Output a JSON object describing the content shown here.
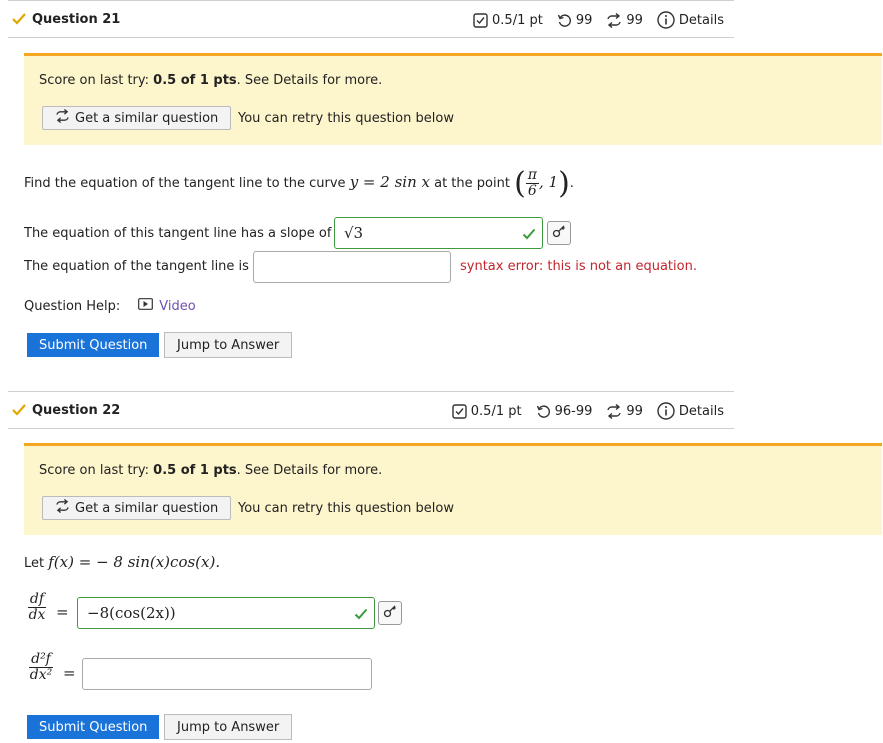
{
  "q21": {
    "title": "Question 21",
    "points": "0.5/1 pt",
    "attempts": "99",
    "retries": "99",
    "details": "Details",
    "banner": {
      "score_prefix": "Score on last try: ",
      "score_value": "0.5 of 1 pts",
      "score_suffix": ". See Details for more.",
      "similar_label": "Get a similar question",
      "retry_text": "You can retry this question below"
    },
    "prompt_prefix": "Find the equation of the tangent line to the curve ",
    "prompt_eq": "y = 2 sin x",
    "prompt_mid": " at the point ",
    "point_num": "π",
    "point_den": "6",
    "point_y": "1",
    "slope_label": "The equation of this tangent line has a slope of",
    "slope_value": "√3",
    "tangent_label": "The equation of the tangent line is",
    "tangent_value": "",
    "error_text": "syntax error: this is not an equation.",
    "help_label": "Question Help:",
    "video_label": "Video",
    "submit_label": "Submit Question",
    "jump_label": "Jump to Answer"
  },
  "q22": {
    "title": "Question 22",
    "points": "0.5/1 pt",
    "attempts": "96-99",
    "retries": "99",
    "details": "Details",
    "banner": {
      "score_prefix": "Score on last try: ",
      "score_value": "0.5 of 1 pts",
      "score_suffix": ". See Details for more.",
      "similar_label": "Get a similar question",
      "retry_text": "You can retry this question below"
    },
    "let_label": "Let ",
    "function_def": "f(x) = − 8 sin(x)cos(x).",
    "d1_num": "df",
    "d1_den": "dx",
    "d1_value": "−8(cos(2x))",
    "d2_num": "d²f",
    "d2_den": "dx²",
    "d2_value": "",
    "submit_label": "Submit Question",
    "jump_label": "Jump to Answer"
  },
  "colors": {
    "banner_bg": "#fdf5cc",
    "banner_border": "#f5a623",
    "submit_bg": "#1a73d9",
    "correct_border": "#3c9b3c",
    "error_text": "#c0262d",
    "check_color": "#e0a800"
  }
}
